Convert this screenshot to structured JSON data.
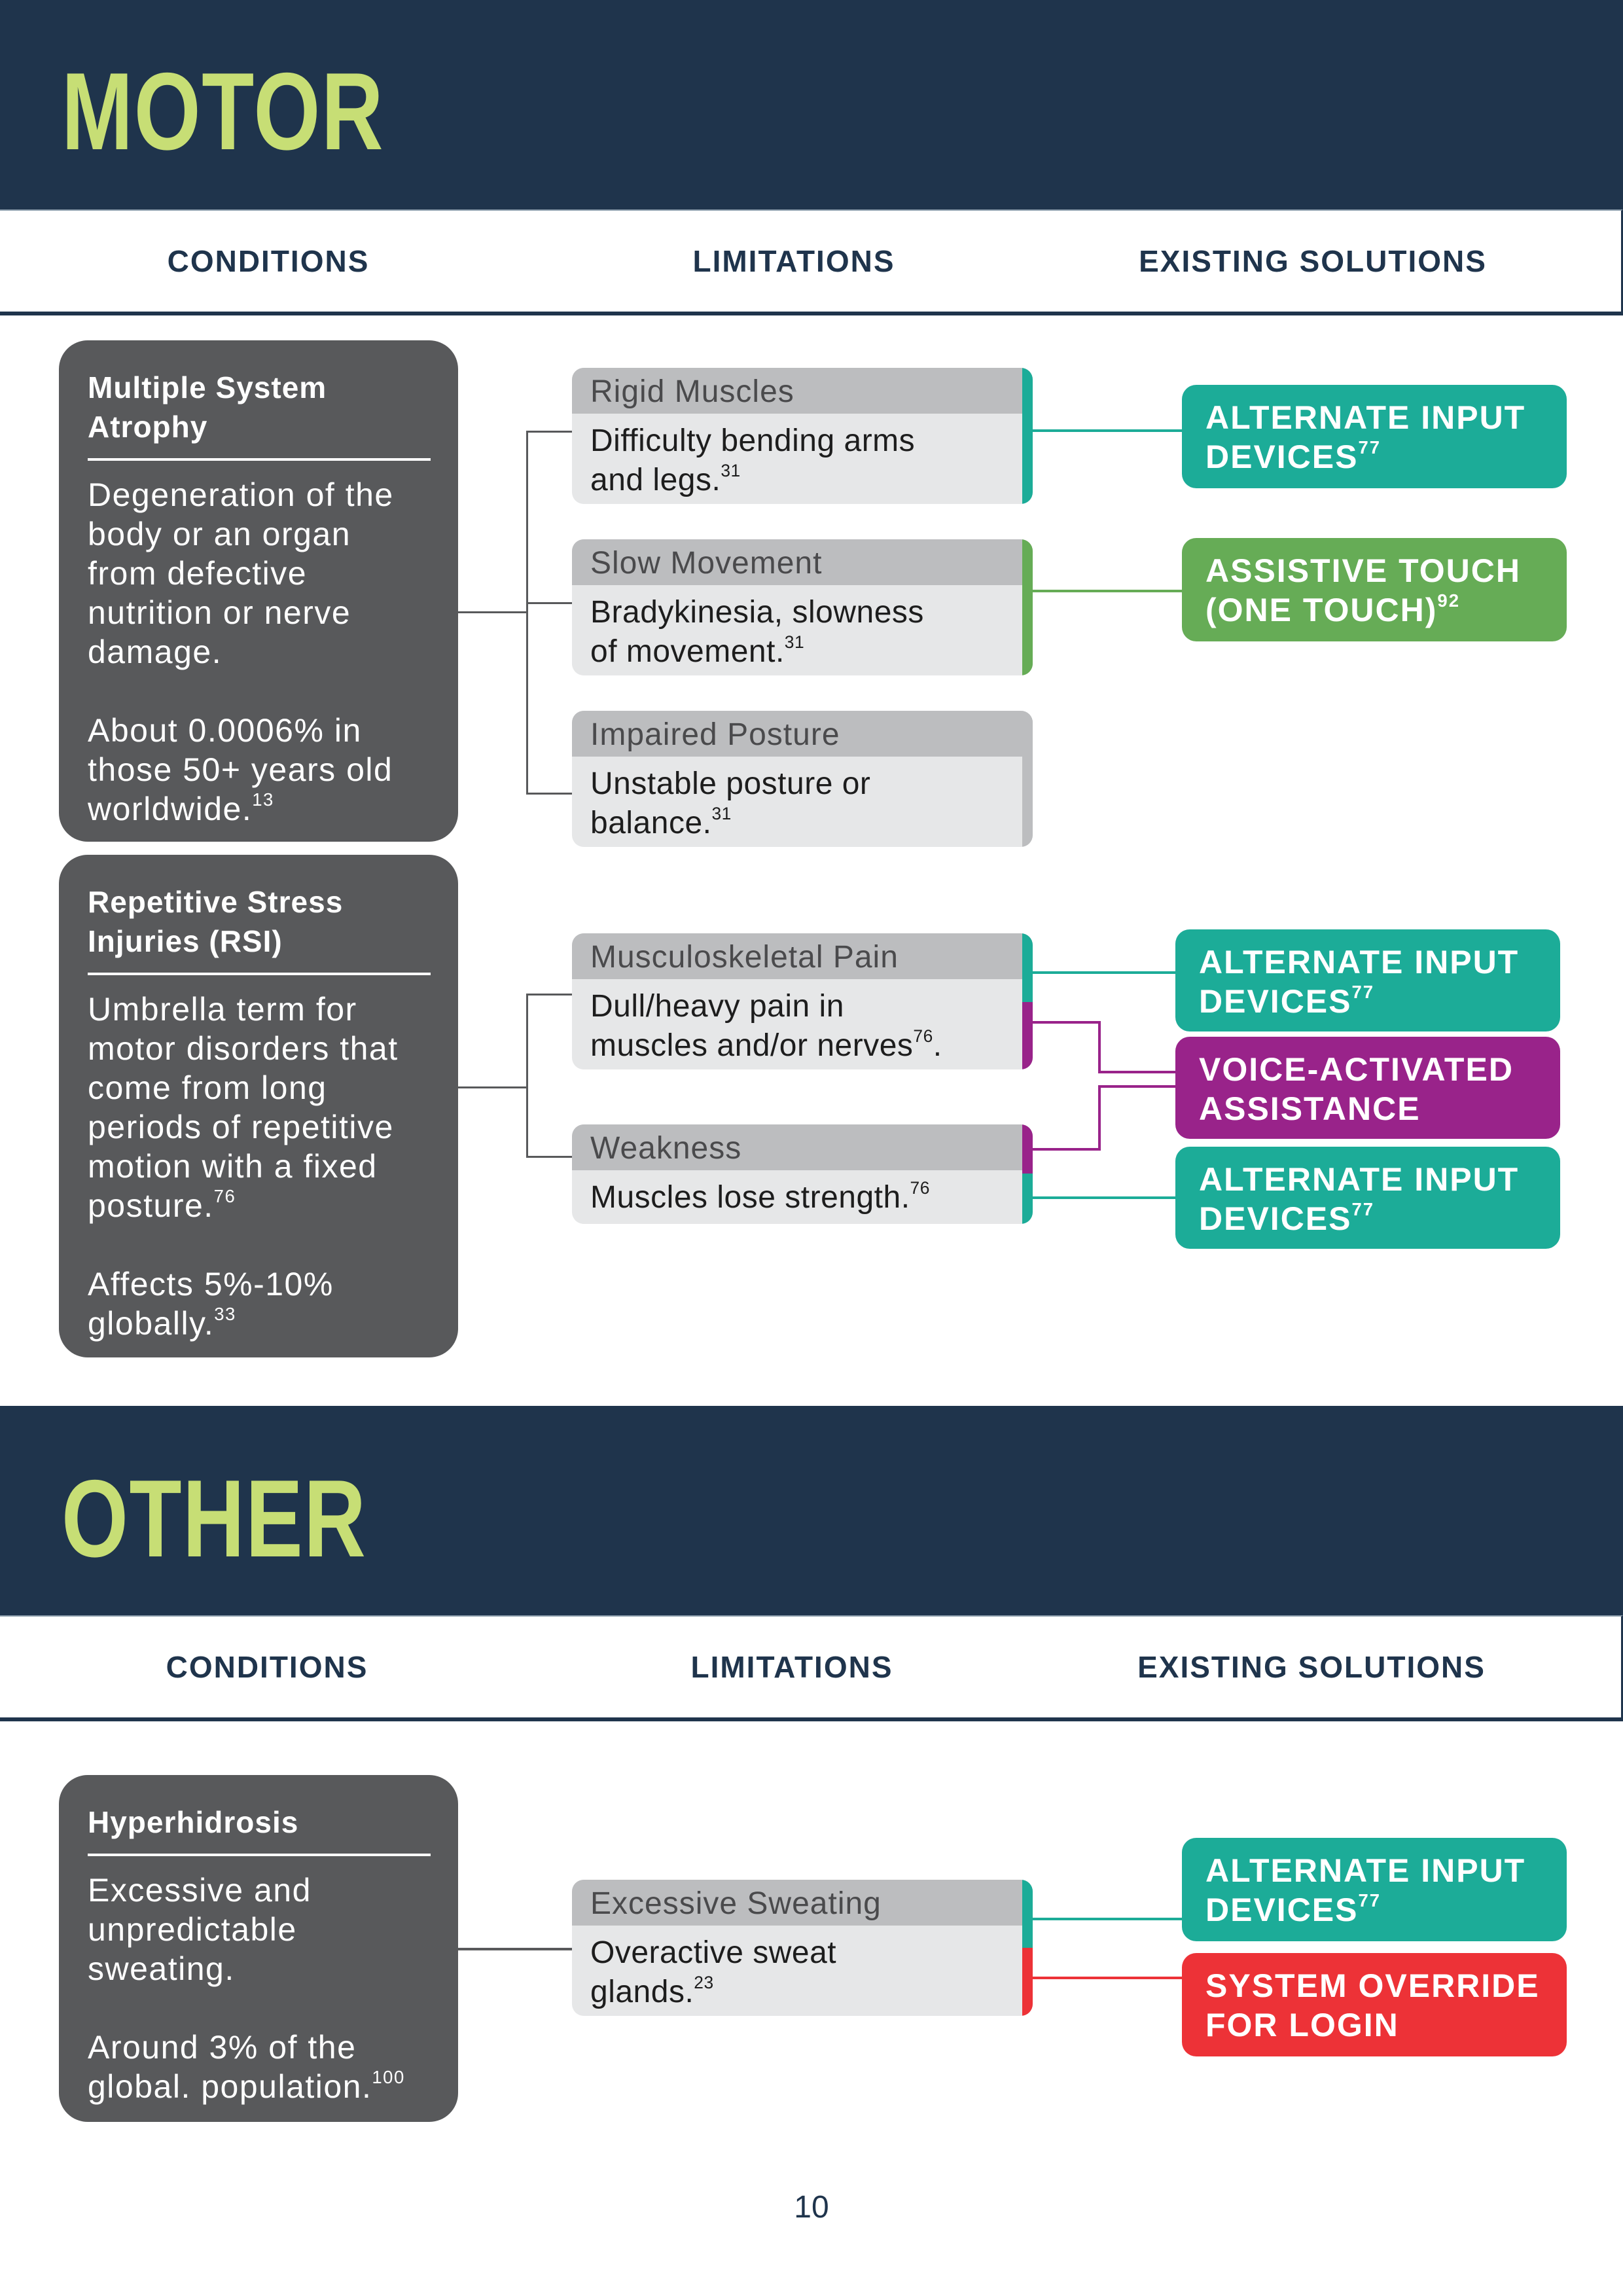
{
  "colors": {
    "navy": "#1f344c",
    "lime": "#c7de75",
    "card_dark": "#58595b",
    "teal": "#1cac98",
    "green": "#66ac56",
    "purple": "#99238a",
    "red": "#ed3237",
    "gray_edge": "#bcbdbf"
  },
  "columns": {
    "conditions": "CONDITIONS",
    "limitations": "LIMITATIONS",
    "solutions": "EXISTING SOLUTIONS"
  },
  "sections": [
    {
      "title": "MOTOR",
      "conditions": [
        {
          "title": "Multiple System\nAtrophy",
          "body": "Degeneration of the\nbody or an organ\nfrom defective\nnutrition or nerve\ndamage.\n\nAbout 0.0006% in\nthose 50+ years old\nworldwide.",
          "ref": "13",
          "limitations": [
            {
              "title": "Rigid Muscles",
              "body": "Difficulty bending arms\nand legs.",
              "ref": "31",
              "solutions": [
                "ALTERNATE INPUT DEVICES"
              ]
            },
            {
              "title": "Slow Movement",
              "body": "Bradykinesia, slowness\nof movement.",
              "ref": "31",
              "solutions": [
                "ASSISTIVE TOUCH (ONE TOUCH)"
              ]
            },
            {
              "title": "Impaired Posture",
              "body": "Unstable posture or\nbalance.",
              "ref": "31",
              "solutions": []
            }
          ]
        },
        {
          "title": "Repetitive Stress\nInjuries (RSI)",
          "body": "Umbrella term for\nmotor disorders that\ncome from long\nperiods of repetitive\nmotion with a fixed\nposture.",
          "body_ref": "76",
          "body2": "Affects 5%-10%\nglobally.",
          "ref": "33",
          "limitations": [
            {
              "title": "Musculoskeletal Pain",
              "body": "Dull/heavy pain in\nmuscles and/or nerves",
              "ref": "76",
              "suffix": ".",
              "solutions": [
                "ALTERNATE INPUT DEVICES",
                "VOICE-ACTIVATED ASSISTANCE"
              ]
            },
            {
              "title": "Weakness",
              "body": "Muscles lose strength.",
              "ref": "76",
              "solutions": [
                "VOICE-ACTIVATED ASSISTANCE",
                "ALTERNATE INPUT DEVICES"
              ]
            }
          ]
        }
      ],
      "solutions": [
        {
          "label": "ALTERNATE INPUT\nDEVICES",
          "ref": "77",
          "color": "teal"
        },
        {
          "label": "ASSISTIVE TOUCH\n(ONE TOUCH)",
          "ref": "92",
          "color": "green"
        },
        {
          "label": "ALTERNATE INPUT\nDEVICES",
          "ref": "77",
          "color": "teal"
        },
        {
          "label": "VOICE-ACTIVATED\nASSISTANCE",
          "ref": "",
          "color": "purple"
        },
        {
          "label": "ALTERNATE INPUT\nDEVICES",
          "ref": "77",
          "color": "teal"
        }
      ]
    },
    {
      "title": "OTHER",
      "conditions": [
        {
          "title": "Hyperhidrosis",
          "body": "Excessive and\nunpredictable\nsweating.\n\nAround 3% of the\nglobal. population.",
          "ref": "100",
          "limitations": [
            {
              "title": "Excessive Sweating",
              "body": "Overactive sweat\nglands.",
              "ref": "23",
              "solutions": [
                "ALTERNATE INPUT DEVICES",
                "SYSTEM OVERRIDE FOR LOGIN"
              ]
            }
          ]
        }
      ],
      "solutions": [
        {
          "label": "ALTERNATE INPUT\nDEVICES",
          "ref": "77",
          "color": "teal"
        },
        {
          "label": "SYSTEM OVERRIDE\nFOR LOGIN",
          "ref": "",
          "color": "red"
        }
      ]
    }
  ],
  "page_number": "10"
}
